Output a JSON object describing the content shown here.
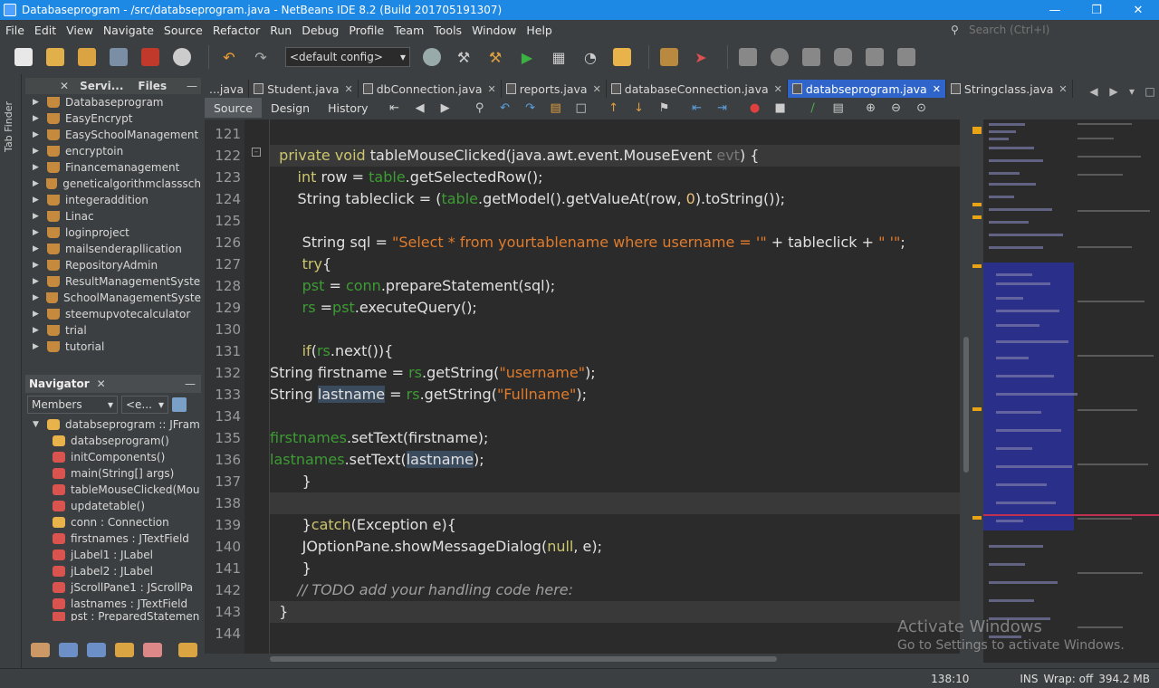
{
  "window": {
    "title": "Databaseprogram - /src/databseprogram.java - NetBeans IDE 8.2 (Build 201705191307)",
    "controls": [
      "—",
      "❐",
      "✕"
    ]
  },
  "menu": [
    "File",
    "Edit",
    "View",
    "Navigate",
    "Source",
    "Refactor",
    "Run",
    "Debug",
    "Profile",
    "Team",
    "Tools",
    "Window",
    "Help"
  ],
  "search": {
    "placeholder": "Search (Ctrl+I)"
  },
  "toolbar": {
    "config": "<default config>"
  },
  "left_strip": {
    "label": "Tab Finder"
  },
  "projects": {
    "tabs": [
      "Servi...",
      "Files"
    ],
    "items": [
      "Databaseprogram",
      "EasyEncrypt",
      "EasySchoolManagement",
      "encryptoin",
      "Financemanagement",
      "geneticalgorithmclasssch",
      "integeraddition",
      "Linac",
      "loginproject",
      "mailsenderapllication",
      "RepositoryAdmin",
      "ResultManagementSyste",
      "SchoolManagementSyste",
      "steemupvotecalculator",
      "trial",
      "tutorial"
    ]
  },
  "navigator": {
    "title": "Navigator",
    "filter": "Members",
    "filter2": "<e...",
    "root": "databseprogram :: JFram",
    "members": [
      {
        "label": "databseprogram()",
        "color": "#e8b34a"
      },
      {
        "label": "initComponents()",
        "color": "#d9534f"
      },
      {
        "label": "main(String[] args)",
        "color": "#d9534f"
      },
      {
        "label": "tableMouseClicked(Mou",
        "color": "#d9534f"
      },
      {
        "label": "updatetable()",
        "color": "#d9534f"
      },
      {
        "label": "conn : Connection",
        "color": "#e8b34a"
      },
      {
        "label": "firstnames : JTextField",
        "color": "#d9534f"
      },
      {
        "label": "jLabel1 : JLabel",
        "color": "#d9534f"
      },
      {
        "label": "jLabel2 : JLabel",
        "color": "#d9534f"
      },
      {
        "label": "jScrollPane1 : JScrollPa",
        "color": "#d9534f"
      },
      {
        "label": "lastnames : JTextField",
        "color": "#d9534f"
      },
      {
        "label": "pst : PreparedStatemen",
        "color": "#d9534f"
      }
    ]
  },
  "editor_tabs": [
    {
      "label": "...java",
      "active": false
    },
    {
      "label": "Student.java",
      "active": false
    },
    {
      "label": "dbConnection.java",
      "active": false
    },
    {
      "label": "reports.java",
      "active": false
    },
    {
      "label": "databaseConnection.java",
      "active": false
    },
    {
      "label": "databseprogram.java",
      "active": true
    },
    {
      "label": "Stringclass.java",
      "active": false
    }
  ],
  "editor_toolbar": {
    "source": "Source",
    "design": "Design",
    "history": "History"
  },
  "code": {
    "line_numbers": [
      "121",
      "122",
      "123",
      "124",
      "125",
      "126",
      "127",
      "128",
      "129",
      "130",
      "131",
      "132",
      "133",
      "134",
      "135",
      "136",
      "137",
      "138",
      "139",
      "140",
      "141",
      "142",
      "143",
      "144"
    ]
  },
  "watermark": {
    "line1": "Activate Windows",
    "line2": "Go to Settings to activate Windows."
  },
  "status": {
    "position": "138:10",
    "mode": "INS",
    "wrap": "Wrap: off",
    "memory": "394.2 MB"
  }
}
